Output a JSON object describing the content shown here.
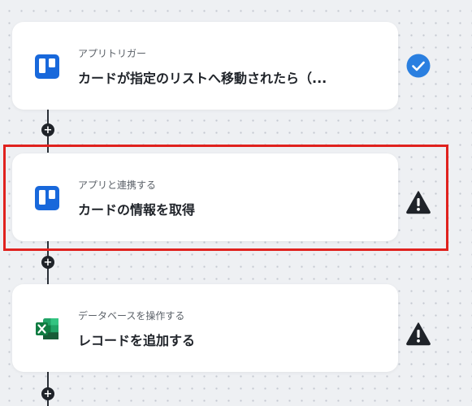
{
  "flow": {
    "steps": [
      {
        "subtitle": "アプリトリガー",
        "title": "カードが指定のリストへ移動されたら（...",
        "app_icon": "trello-icon",
        "status": "success",
        "status_icon": "check-circle-icon"
      },
      {
        "subtitle": "アプリと連携する",
        "title": "カードの情報を取得",
        "app_icon": "trello-icon",
        "status": "warning",
        "status_icon": "warning-triangle-icon"
      },
      {
        "subtitle": "データベースを操作する",
        "title": "レコードを追加する",
        "app_icon": "excel-icon",
        "status": "warning",
        "status_icon": "warning-triangle-icon"
      }
    ],
    "add_step_symbol": "+"
  },
  "colors": {
    "trello_blue": "#1868db",
    "success_blue": "#2a7fe0",
    "warning_black": "#1f2329",
    "excel_green": "#1d6f42",
    "highlight_red": "#e0221e"
  }
}
